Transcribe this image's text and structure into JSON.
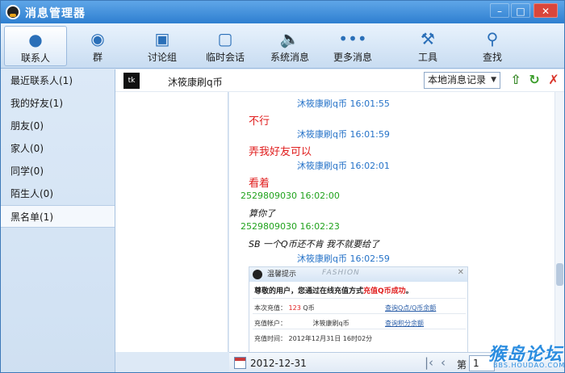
{
  "window": {
    "title": "消息管理器"
  },
  "toolbar": {
    "items": [
      {
        "label": "联系人",
        "icon": "contact-person-icon"
      },
      {
        "label": "群",
        "icon": "group-icon"
      },
      {
        "label": "讨论组",
        "icon": "discussion-icon"
      },
      {
        "label": "临时会话",
        "icon": "temp-chat-icon"
      },
      {
        "label": "系统消息",
        "icon": "speaker-icon"
      },
      {
        "label": "更多消息",
        "icon": "more-icon"
      },
      {
        "label": "工具",
        "icon": "wrench-icon"
      },
      {
        "label": "查找",
        "icon": "search-icon"
      }
    ],
    "active": "联系人"
  },
  "sidebar": {
    "items": [
      {
        "label": "最近联系人(1)"
      },
      {
        "label": "我的好友(1)"
      },
      {
        "label": "朋友(0)"
      },
      {
        "label": "家人(0)"
      },
      {
        "label": "同学(0)"
      },
      {
        "label": "陌生人(0)"
      },
      {
        "label": "黑名单(1)"
      }
    ],
    "active": "黑名单(1)"
  },
  "contact": {
    "name": "沐筱康刷q币",
    "avatar_text": "tk"
  },
  "history": {
    "select_value": "本地消息记录"
  },
  "messages": [
    {
      "type": "head",
      "who": "self",
      "text": "沐筱康刷q币    16:01:55"
    },
    {
      "type": "text",
      "style": "red",
      "text": "不行"
    },
    {
      "type": "head",
      "who": "self",
      "text": "沐筱康刷q币    16:01:59"
    },
    {
      "type": "text",
      "style": "red",
      "text": "弄我好友可以"
    },
    {
      "type": "head",
      "who": "self",
      "text": "沐筱康刷q币    16:02:01"
    },
    {
      "type": "text",
      "style": "red",
      "text": "看着"
    },
    {
      "type": "head",
      "who": "other",
      "text": "2529809030  16:02:00"
    },
    {
      "type": "text",
      "style": "ital",
      "text": "算你了"
    },
    {
      "type": "head",
      "who": "other",
      "text": "2529809030  16:02:23"
    },
    {
      "type": "text",
      "style": "ital",
      "text": "SB    一个Q币还不肯  我不就要给了"
    },
    {
      "type": "head",
      "who": "self",
      "text": "沐筱康刷q币    16:02:59"
    }
  ],
  "notice": {
    "title": "温馨提示",
    "brand": "FASHION",
    "message_before": "尊敬的用户，您通过在线充值方式",
    "message_highlight": "充值Q币成功",
    "message_after": "。",
    "rows": [
      {
        "label": "本次充值：",
        "value": "123",
        "suffix": "Q币",
        "link": "查询Q点/Q币余额"
      },
      {
        "label": "充值帐户：",
        "value": "沐筱康刷q币",
        "suffix": "",
        "link": "查询积分余额"
      },
      {
        "label": "充值时间：",
        "value": "2012年12月31日  16时02分",
        "suffix": "",
        "link": ""
      }
    ]
  },
  "footer": {
    "date": "2012-12-31",
    "page_label": "第",
    "page_value": "1"
  },
  "watermark": {
    "main": "猴岛论坛",
    "sub": "BBS.HOUDAO.COM"
  },
  "colors": {
    "self_name": "#2673c8",
    "other_name": "#21a31e",
    "highlight_red": "#e01d1d"
  }
}
